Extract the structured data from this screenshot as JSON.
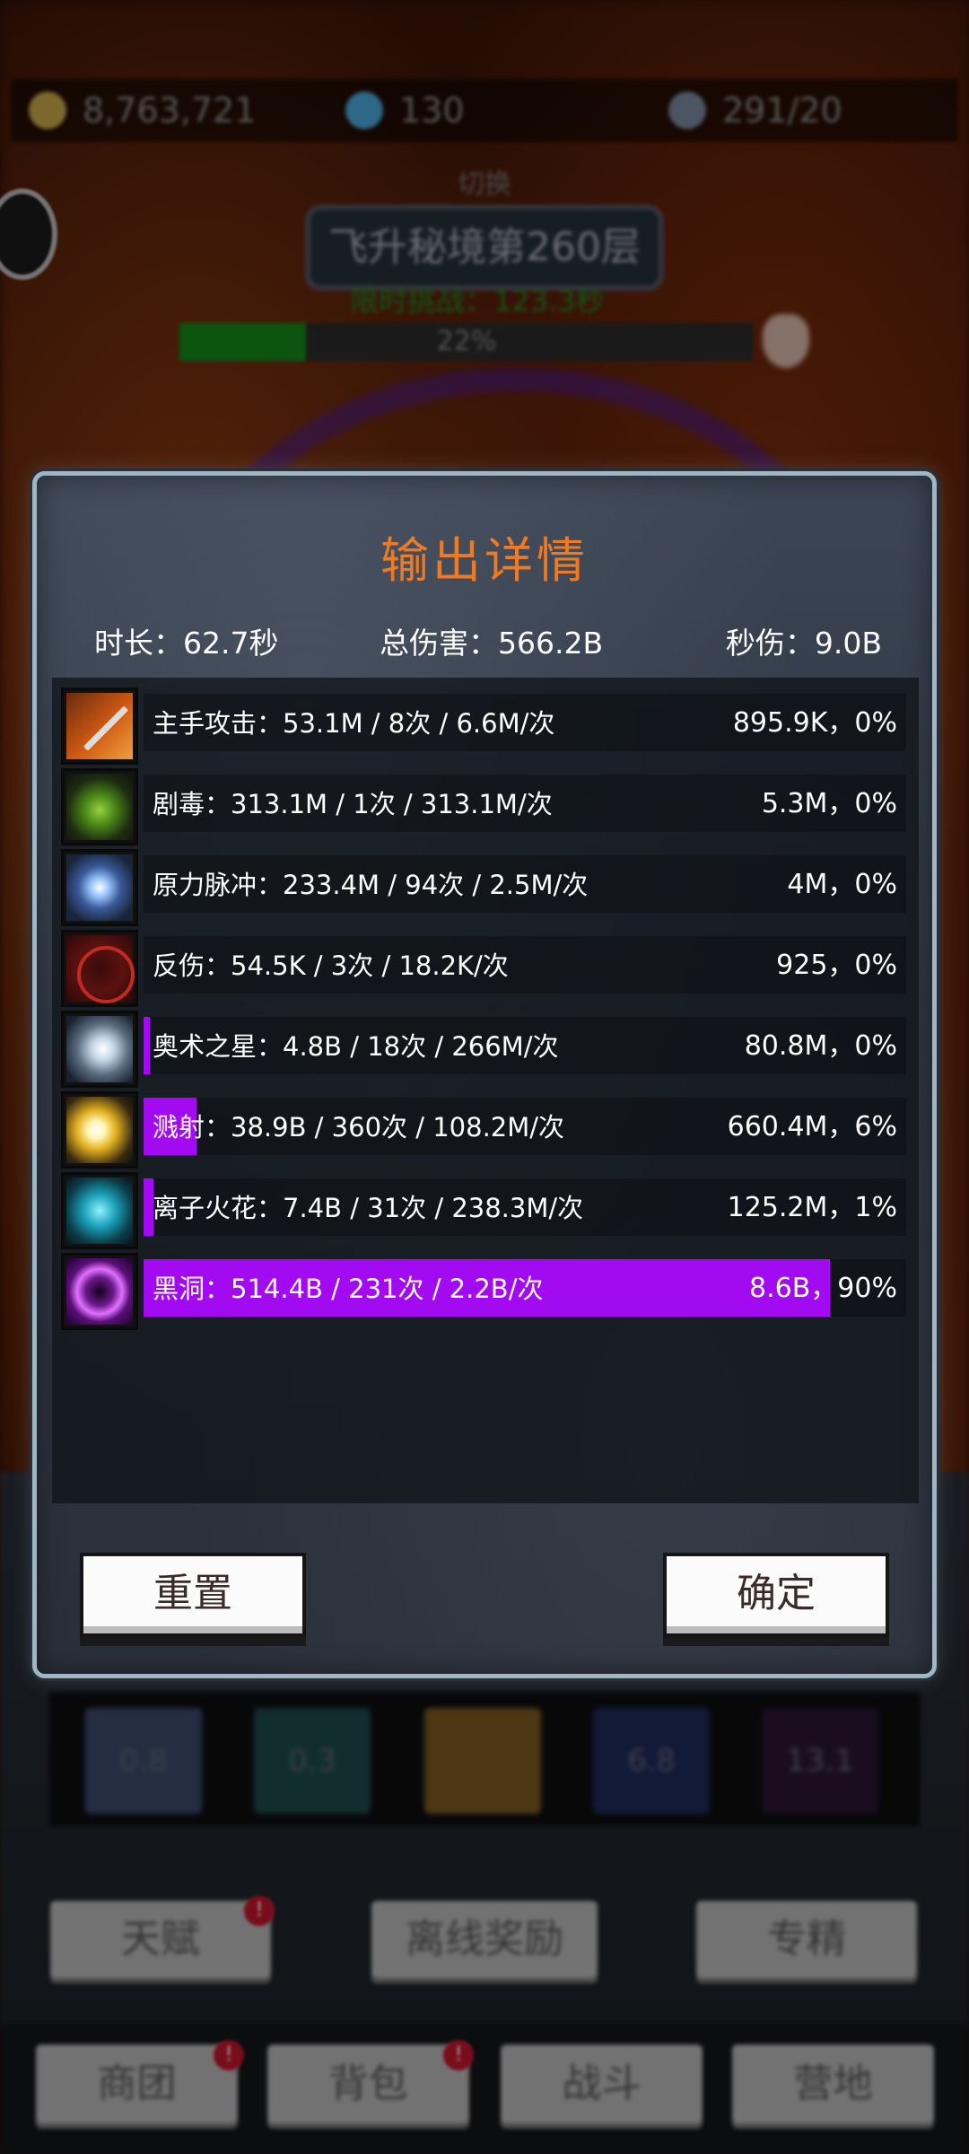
{
  "hud": {
    "gold": "8,763,721",
    "gems": "130",
    "stamina": "291/20",
    "stage_switch": "切换",
    "stage_name": "飞升秘境第260层",
    "limit_text": "限时挑战：123.3秒",
    "progress_text": "22%",
    "progress": 0.22
  },
  "dialog": {
    "title": "输出详情",
    "duration": "时长：62.7秒",
    "total_damage": "总伤害：566.2B",
    "dps": "秒伤：9.0B",
    "rows": [
      {
        "label": "主手攻击：53.1M  /  8次  /  6.6M/次",
        "right": "895.9K，0%",
        "share": 0.0,
        "icon": "sword-icon"
      },
      {
        "label": "剧毒：313.1M  /  1次  /  313.1M/次",
        "right": "5.3M，0%",
        "share": 0.0,
        "icon": "poison-icon"
      },
      {
        "label": "原力脉冲：233.4M  /  94次  /  2.5M/次",
        "right": "4M，0%",
        "share": 0.0,
        "icon": "force-pulse-icon"
      },
      {
        "label": "反伤：54.5K  /  3次  /  18.2K/次",
        "right": "925，0%",
        "share": 0.0,
        "icon": "thorns-icon"
      },
      {
        "label": "奥术之星：4.8B  /  18次  /  266M/次",
        "right": "80.8M，0%",
        "share": 0.008,
        "icon": "arcane-star-icon"
      },
      {
        "label": "溅射：38.9B  /  360次  /  108.2M/次",
        "right": "660.4M，6%",
        "share": 0.069,
        "icon": "splash-icon"
      },
      {
        "label": "离子火花：7.4B  /  31次  /  238.3M/次",
        "right": "125.2M，1%",
        "share": 0.013,
        "icon": "ion-spark-icon"
      },
      {
        "label": "黑洞：514.4B  /  231次  /  2.2B/次",
        "right": "8.6B，90%",
        "share": 0.9,
        "icon": "black-hole-icon"
      }
    ],
    "reset_button": "重置",
    "confirm_button": "确定"
  },
  "skill_slots": [
    "0.8",
    "0.3",
    "",
    "6.8",
    "13.1"
  ],
  "menu": {
    "talent": "天赋",
    "offline_reward": "离线奖励",
    "specialization": "专精"
  },
  "bottom_nav": {
    "guild": "商团",
    "backpack": "背包",
    "battle": "战斗",
    "camp": "营地"
  },
  "colors": {
    "title": "#f07a22",
    "bar_fill": "#a20bf2"
  }
}
